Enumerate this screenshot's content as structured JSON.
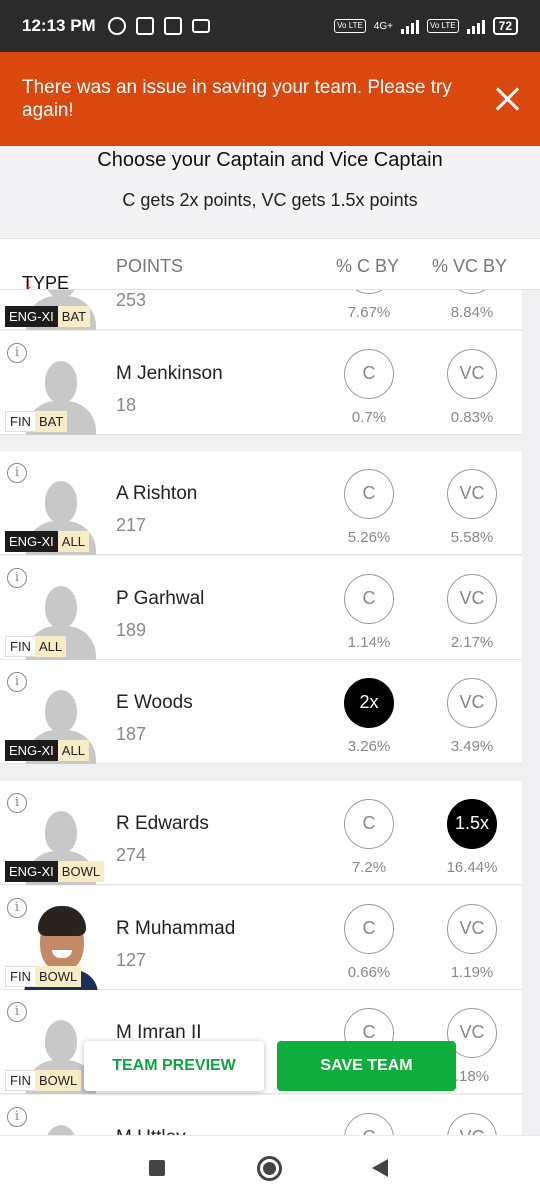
{
  "status_bar": {
    "time": "12:13 PM",
    "network": "4G+",
    "volte_label": "Vo LTE",
    "battery": "72",
    "icons": [
      "mute-bell-icon",
      "b-app-icon",
      "shield-app-icon",
      "vr-icon",
      "volte-icon",
      "signal-icon",
      "battery-icon"
    ]
  },
  "error_banner": {
    "message": "There was an issue in saving your team. Please try again!",
    "close_icon": "close-icon",
    "color": "#d9480f"
  },
  "header": {
    "title": "Choose your Captain and Vice Captain",
    "subtitle": "C gets 2x points, VC gets 1.5x points"
  },
  "columns": {
    "type": "TYPE",
    "sort_icon": "arrow-down-icon",
    "points": "POINTS",
    "c_by": "% C BY",
    "vc_by": "% VC BY"
  },
  "players": [
    {
      "name": "",
      "points": "253",
      "team": "ENG-XI",
      "role": "BAT",
      "c_label": "C",
      "vc_label": "VC",
      "c_pct": "7.67%",
      "vc_pct": "8.84%",
      "c_selected": false,
      "vc_selected": false,
      "team_dark": true,
      "photo": false
    },
    {
      "name": "M Jenkinson",
      "points": "18",
      "team": "FIN",
      "role": "BAT",
      "c_label": "C",
      "vc_label": "VC",
      "c_pct": "0.7%",
      "vc_pct": "0.83%",
      "c_selected": false,
      "vc_selected": false,
      "team_dark": false,
      "photo": false
    },
    {
      "name": "A Rishton",
      "points": "217",
      "team": "ENG-XI",
      "role": "ALL",
      "c_label": "C",
      "vc_label": "VC",
      "c_pct": "5.26%",
      "vc_pct": "5.58%",
      "c_selected": false,
      "vc_selected": false,
      "team_dark": true,
      "photo": false
    },
    {
      "name": "P Garhwal",
      "points": "189",
      "team": "FIN",
      "role": "ALL",
      "c_label": "C",
      "vc_label": "VC",
      "c_pct": "1.14%",
      "vc_pct": "2.17%",
      "c_selected": false,
      "vc_selected": false,
      "team_dark": false,
      "photo": false
    },
    {
      "name": "E Woods",
      "points": "187",
      "team": "ENG-XI",
      "role": "ALL",
      "c_label": "2x",
      "vc_label": "VC",
      "c_pct": "3.26%",
      "vc_pct": "3.49%",
      "c_selected": true,
      "vc_selected": false,
      "team_dark": true,
      "photo": false
    },
    {
      "name": "R Edwards",
      "points": "274",
      "team": "ENG-XI",
      "role": "BOWL",
      "c_label": "C",
      "vc_label": "1.5x",
      "c_pct": "7.2%",
      "vc_pct": "16.44%",
      "c_selected": false,
      "vc_selected": true,
      "team_dark": true,
      "photo": false
    },
    {
      "name": "R Muhammad",
      "points": "127",
      "team": "FIN",
      "role": "BOWL",
      "c_label": "C",
      "vc_label": "VC",
      "c_pct": "0.66%",
      "vc_pct": "1.19%",
      "c_selected": false,
      "vc_selected": false,
      "team_dark": false,
      "photo": true
    },
    {
      "name": "M Imran II",
      "points": "",
      "team": "FIN",
      "role": "BOWL",
      "c_label": "C",
      "vc_label": "VC",
      "c_pct": "",
      "vc_pct": ".18%",
      "c_selected": false,
      "vc_selected": false,
      "team_dark": false,
      "photo": false
    },
    {
      "name": "M Uttley",
      "points": "",
      "team": "",
      "role": "",
      "c_label": "C",
      "vc_label": "VC",
      "c_pct": "",
      "vc_pct": "",
      "c_selected": false,
      "vc_selected": false,
      "team_dark": false,
      "photo": false
    }
  ],
  "actions": {
    "preview_label": "TEAM PREVIEW",
    "save_label": "SAVE TEAM",
    "save_color": "#0ead3c"
  },
  "nav_bar": {
    "icons": [
      "recents-icon",
      "home-icon",
      "back-icon"
    ]
  }
}
